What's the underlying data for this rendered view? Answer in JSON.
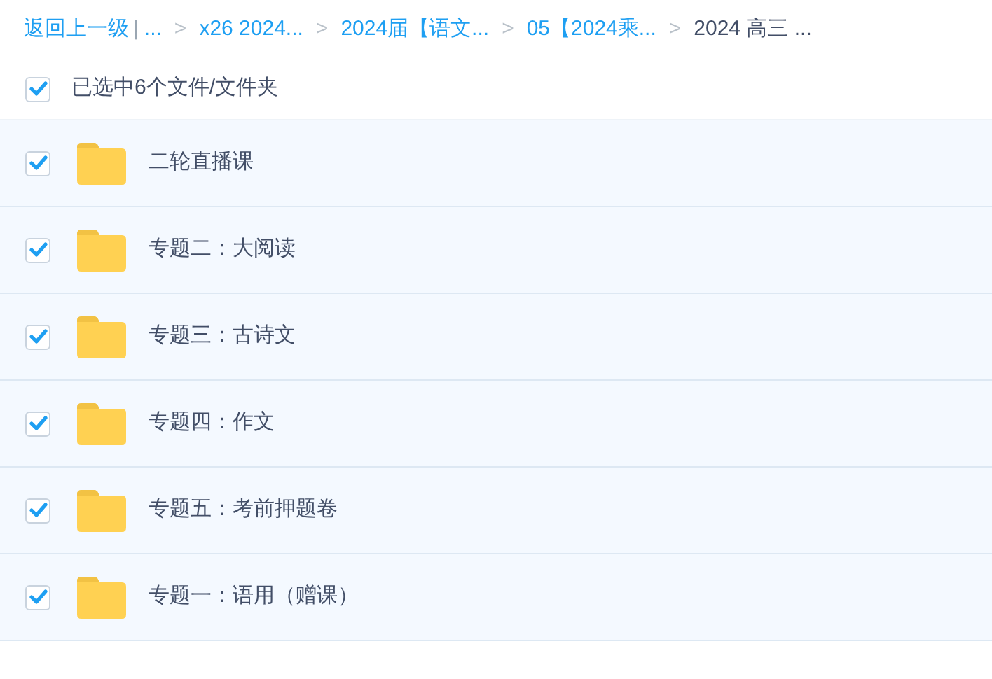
{
  "breadcrumb": {
    "back": "返回上一级",
    "separator": "|",
    "items": [
      {
        "label": "...",
        "current": false
      },
      {
        "label": "x26 2024...",
        "current": false
      },
      {
        "label": "2024届【语文...",
        "current": false
      },
      {
        "label": "05【2024乘...",
        "current": false
      },
      {
        "label": "2024 高三 ...",
        "current": true
      }
    ],
    "arrow": ">"
  },
  "selection": {
    "checked": true,
    "label": "已选中6个文件/文件夹"
  },
  "files": [
    {
      "name": "二轮直播课",
      "checked": true
    },
    {
      "name": "专题二：大阅读",
      "checked": true
    },
    {
      "name": "专题三：古诗文",
      "checked": true
    },
    {
      "name": "专题四：作文",
      "checked": true
    },
    {
      "name": "专题五：考前押题卷",
      "checked": true
    },
    {
      "name": "专题一：语用（赠课）",
      "checked": true
    }
  ]
}
